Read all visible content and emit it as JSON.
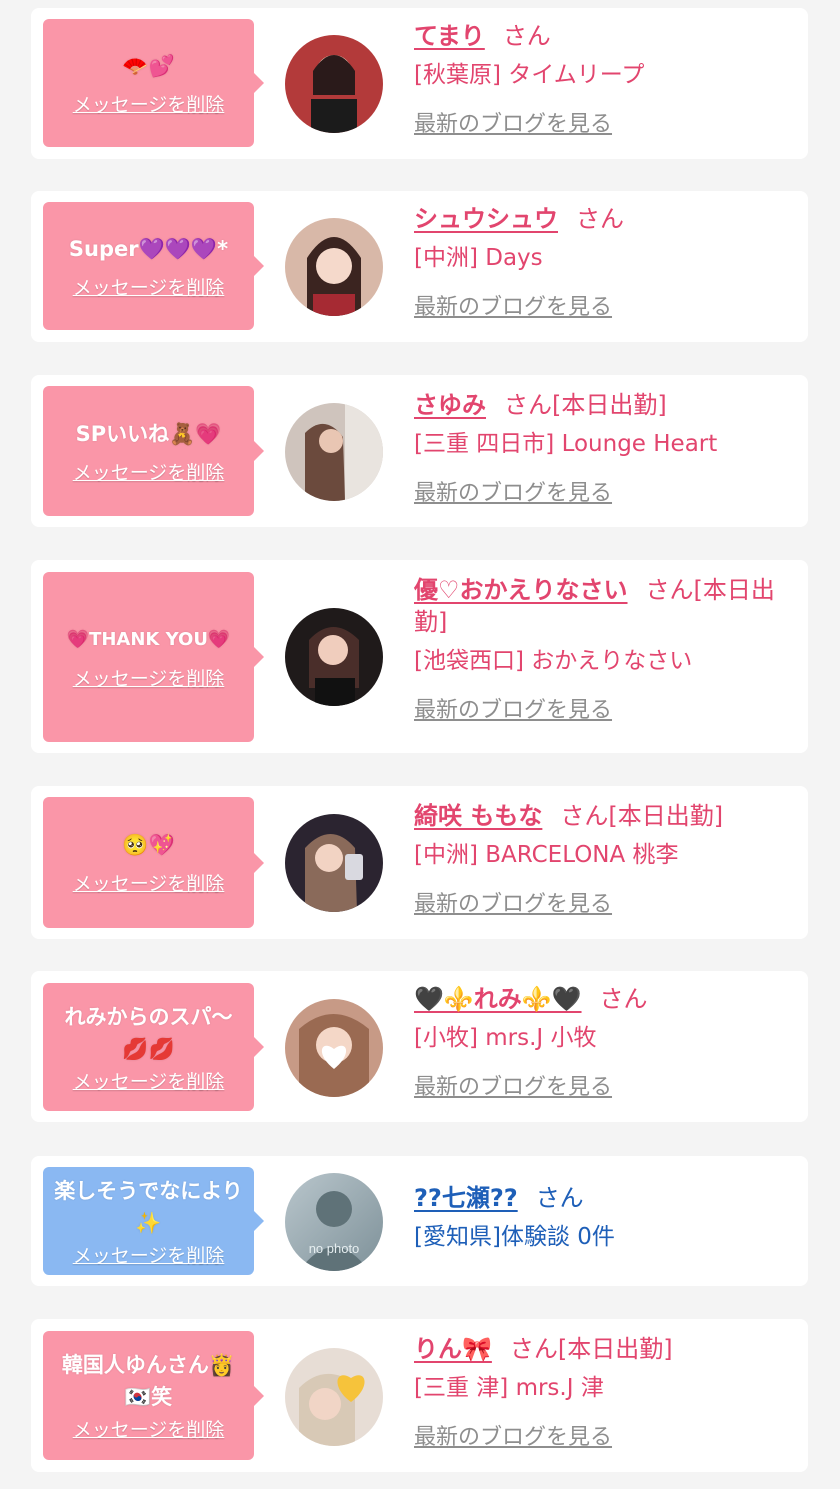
{
  "colors": {
    "accent": "#e2456e",
    "bubble_pink": "#fa96a8",
    "bubble_blue": "#8ab8f2",
    "link_gray": "#8e8e8e",
    "blue": "#1e5fb8"
  },
  "delete_label": "メッセージを削除",
  "blog_label": "最新のブログを見る",
  "san_label": "さん",
  "cards": [
    {
      "stamp": "🪭💕",
      "name": "てまり",
      "status": "",
      "shop": "[秋葉原] タイムリープ"
    },
    {
      "stamp": "Super💜💜💜*",
      "name": "シュウシュウ",
      "status": "",
      "shop": "[中洲] Days"
    },
    {
      "stamp": "SPいいね🧸💗",
      "name": "さゆみ",
      "status": "[本日出勤]",
      "shop": "[三重 四日市] Lounge Heart"
    },
    {
      "stamp": "💗THANK YOU💗",
      "name": "優♡おかえりなさい",
      "status": "[本日出勤]",
      "shop": "[池袋西口] おかえりなさい"
    },
    {
      "stamp": "🥺💖",
      "name": "綺咲 ももな",
      "status": "[本日出勤]",
      "shop": "[中洲] BARCELONA 桃李"
    },
    {
      "stamp": "れみからのスパ〜💋💋",
      "name": "🖤⚜️れみ⚜️🖤",
      "status": "",
      "shop": "[小牧] mrs.J 小牧"
    },
    {
      "stamp": "楽しそうでなにより✨",
      "name": "??七瀬??",
      "status": "",
      "shop": "[愛知県]体験談 0件",
      "no_photo_text": "no photo"
    },
    {
      "stamp": "韓国人ゆんさん👸🇰🇷笑",
      "name": "りん🎀",
      "status": "[本日出勤]",
      "shop": "[三重 津] mrs.J 津"
    }
  ]
}
